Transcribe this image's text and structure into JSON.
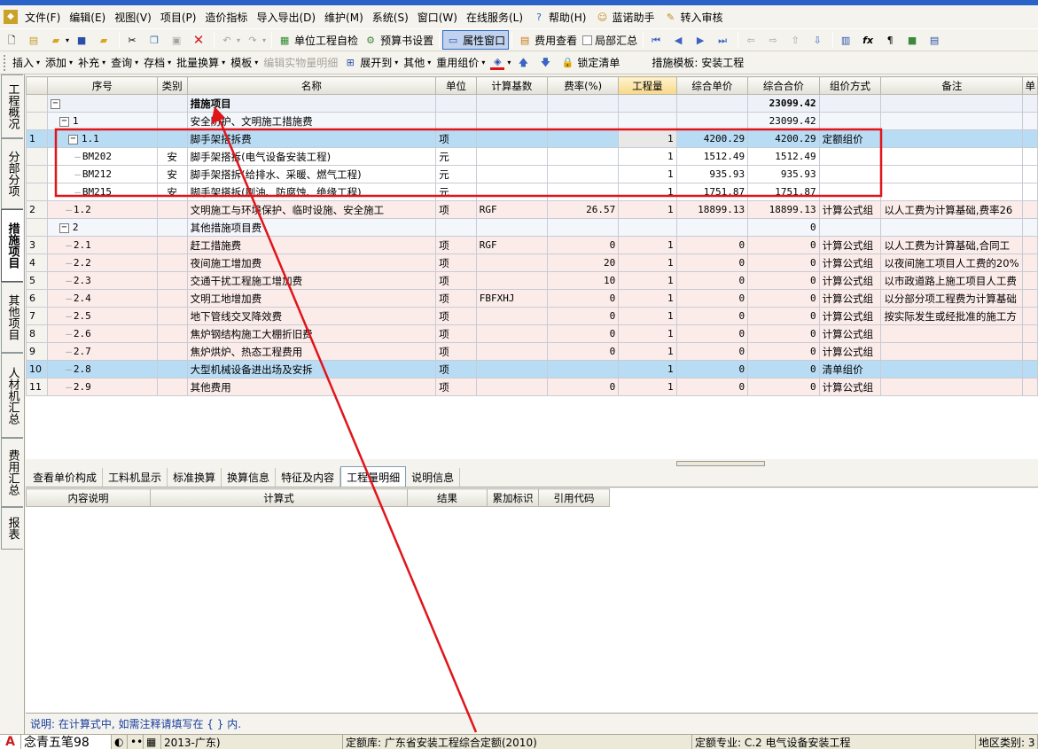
{
  "menu": [
    "文件(F)",
    "编辑(E)",
    "视图(V)",
    "项目(P)",
    "造价指标",
    "导入导出(D)",
    "维护(M)",
    "系统(S)",
    "窗口(W)",
    "在线服务(L)",
    "帮助(H)",
    "蓝诺助手",
    "转入审核"
  ],
  "toolbar1": {
    "self_check": "单位工程自检",
    "budget_settings": "预算书设置",
    "property_window": "属性窗口",
    "fee_view": "费用查看",
    "partial_summary": "局部汇总"
  },
  "toolbar2": {
    "insert": "插入",
    "add": "添加",
    "supplement": "补充",
    "query": "查询",
    "save": "存档",
    "batch_replace": "批量换算",
    "template": "模板",
    "edit_detail": "编辑实物量明细",
    "expand_to": "展开到",
    "other": "其他",
    "reuse_price": "重用组价",
    "lock_list": "锁定清单",
    "template_label": "措施模板: 安装工程"
  },
  "side_tabs": [
    "工程概况",
    "分部分项",
    "措施项目",
    "其他项目",
    "人材机汇总",
    "费用汇总",
    "报表"
  ],
  "grid": {
    "columns": [
      "",
      "序号",
      "类别",
      "名称",
      "单位",
      "计算基数",
      "费率(%)",
      "工程量",
      "综合单价",
      "综合合价",
      "组价方式",
      "备注",
      "单"
    ],
    "rows": [
      {
        "rn": "",
        "seq": "",
        "cat": "",
        "name": "措施项目",
        "unit": "",
        "base": "",
        "rate": "",
        "qty": "",
        "price": "",
        "total": "23099.42",
        "method": "",
        "note": ""
      },
      {
        "rn": "",
        "seq": "1",
        "cat": "",
        "name": "安全防护、文明施工措施费",
        "unit": "",
        "base": "",
        "rate": "",
        "qty": "",
        "price": "",
        "total": "23099.42",
        "method": "",
        "note": ""
      },
      {
        "rn": "1",
        "seq": "1.1",
        "cat": "",
        "name": "脚手架搭拆费",
        "unit": "项",
        "base": "",
        "rate": "",
        "qty": "1",
        "price": "4200.29",
        "total": "4200.29",
        "method": "定额组价",
        "note": ""
      },
      {
        "rn": "",
        "seq": "BM202",
        "cat": "安",
        "name": "脚手架搭拆(电气设备安装工程)",
        "unit": "元",
        "base": "",
        "rate": "",
        "qty": "1",
        "price": "1512.49",
        "total": "1512.49",
        "method": "",
        "note": ""
      },
      {
        "rn": "",
        "seq": "BM212",
        "cat": "安",
        "name": "脚手架搭拆(给排水、采暖、燃气工程)",
        "unit": "元",
        "base": "",
        "rate": "",
        "qty": "1",
        "price": "935.93",
        "total": "935.93",
        "method": "",
        "note": ""
      },
      {
        "rn": "",
        "seq": "BM215",
        "cat": "安",
        "name": "脚手架搭拆(刷油、防腐蚀、绝缘工程)",
        "unit": "元",
        "base": "",
        "rate": "",
        "qty": "1",
        "price": "1751.87",
        "total": "1751.87",
        "method": "",
        "note": ""
      },
      {
        "rn": "2",
        "seq": "1.2",
        "cat": "",
        "name": "文明施工与环境保护、临时设施、安全施工",
        "unit": "项",
        "base": "RGF",
        "rate": "26.57",
        "qty": "1",
        "price": "18899.13",
        "total": "18899.13",
        "method": "计算公式组",
        "note": "以人工费为计算基础,费率26"
      },
      {
        "rn": "",
        "seq": "2",
        "cat": "",
        "name": "其他措施项目费",
        "unit": "",
        "base": "",
        "rate": "",
        "qty": "",
        "price": "",
        "total": "0",
        "method": "",
        "note": ""
      },
      {
        "rn": "3",
        "seq": "2.1",
        "cat": "",
        "name": "赶工措施费",
        "unit": "项",
        "base": "RGF",
        "rate": "0",
        "qty": "1",
        "price": "0",
        "total": "0",
        "method": "计算公式组",
        "note": "以人工费为计算基础,合同工"
      },
      {
        "rn": "4",
        "seq": "2.2",
        "cat": "",
        "name": "夜间施工增加费",
        "unit": "项",
        "base": "",
        "rate": "20",
        "qty": "1",
        "price": "0",
        "total": "0",
        "method": "计算公式组",
        "note": "以夜间施工项目人工费的20%"
      },
      {
        "rn": "5",
        "seq": "2.3",
        "cat": "",
        "name": "交通干扰工程施工增加费",
        "unit": "项",
        "base": "",
        "rate": "10",
        "qty": "1",
        "price": "0",
        "total": "0",
        "method": "计算公式组",
        "note": "以市政道路上施工项目人工费"
      },
      {
        "rn": "6",
        "seq": "2.4",
        "cat": "",
        "name": "文明工地增加费",
        "unit": "项",
        "base": "FBFXHJ",
        "rate": "0",
        "qty": "1",
        "price": "0",
        "total": "0",
        "method": "计算公式组",
        "note": "以分部分项工程费为计算基础"
      },
      {
        "rn": "7",
        "seq": "2.5",
        "cat": "",
        "name": "地下管线交叉降效费",
        "unit": "项",
        "base": "",
        "rate": "0",
        "qty": "1",
        "price": "0",
        "total": "0",
        "method": "计算公式组",
        "note": "按实际发生或经批准的施工方"
      },
      {
        "rn": "8",
        "seq": "2.6",
        "cat": "",
        "name": "焦炉钢结构施工大棚折旧费",
        "unit": "项",
        "base": "",
        "rate": "0",
        "qty": "1",
        "price": "0",
        "total": "0",
        "method": "计算公式组",
        "note": ""
      },
      {
        "rn": "9",
        "seq": "2.7",
        "cat": "",
        "name": "焦炉烘炉、热态工程费用",
        "unit": "项",
        "base": "",
        "rate": "0",
        "qty": "1",
        "price": "0",
        "total": "0",
        "method": "计算公式组",
        "note": ""
      },
      {
        "rn": "10",
        "seq": "2.8",
        "cat": "",
        "name": "大型机械设备进出场及安拆",
        "unit": "项",
        "base": "",
        "rate": "",
        "qty": "1",
        "price": "0",
        "total": "0",
        "method": "清单组价",
        "note": ""
      },
      {
        "rn": "11",
        "seq": "2.9",
        "cat": "",
        "name": "其他费用",
        "unit": "项",
        "base": "",
        "rate": "0",
        "qty": "1",
        "price": "0",
        "total": "0",
        "method": "计算公式组",
        "note": ""
      }
    ]
  },
  "bottom_tabs": [
    "查看单价构成",
    "工料机显示",
    "标准换算",
    "换算信息",
    "特征及内容",
    "工程量明细",
    "说明信息"
  ],
  "bottom_columns": [
    "内容说明",
    "计算式",
    "结果",
    "累加标识",
    "引用代码"
  ],
  "hint": "说明: 在计算式中, 如需注释请填写在 { } 内.",
  "status": {
    "ime": "念青五笔98",
    "standard": "2013-广东)",
    "quota_lib": "定额库: 广东省安装工程综合定额(2010)",
    "quota_major": "定额专业: C.2 电气设备安装工程",
    "region": "地区类别: 3"
  },
  "colors": {
    "annotation": "#e0151a",
    "selected_row": "#b9dcf5",
    "pink_row": "#fbecea"
  }
}
